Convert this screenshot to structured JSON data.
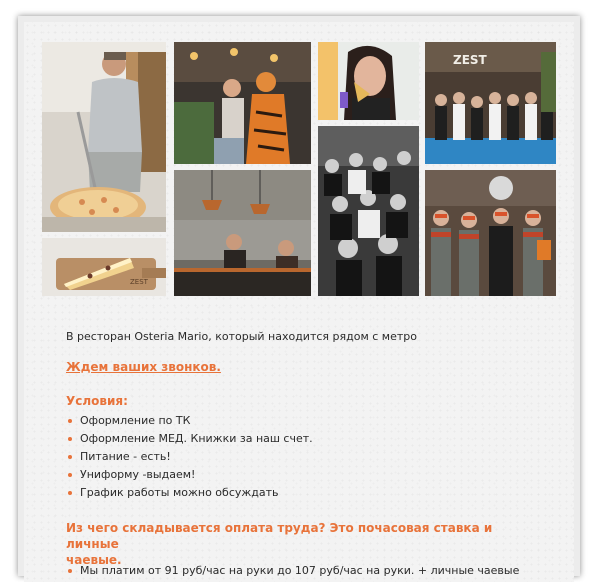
{
  "gallery": {
    "images": [
      "chef-making-pizza-photo",
      "guests-in-costumes-photo",
      "woman-eating-pizza-photo",
      "team-group-photo-zest",
      "crowd-party-bw-photo",
      "pizza-slice-board-photo",
      "open-kitchen-chefs-photo",
      "staff-in-masks-photo"
    ],
    "sign_text": "ZEST"
  },
  "content": {
    "intro": "В ресторан Osteria Mario, который находится рядом с метро",
    "cta": "Ждем ваших звонков.",
    "conditions_title": "Условия:",
    "conditions": [
      "Оформление по ТК",
      "Оформление МЕД. Книжки за наш счет.",
      "Питание - есть!",
      "Униформу -выдаем!",
      "График работы можно обсуждать"
    ],
    "pay_title_line1": "Из чего складывается оплата труда? Это почасовая ставка и личные",
    "pay_title_line2": "чаевые.",
    "pay_items": [
      "Мы платим от 91 руб/час на руки до 107 руб/час на руки. + личные чаевые"
    ]
  },
  "colors": {
    "accent": "#e8733a",
    "text": "#2a2a2a",
    "page": "#f3f3f3"
  }
}
